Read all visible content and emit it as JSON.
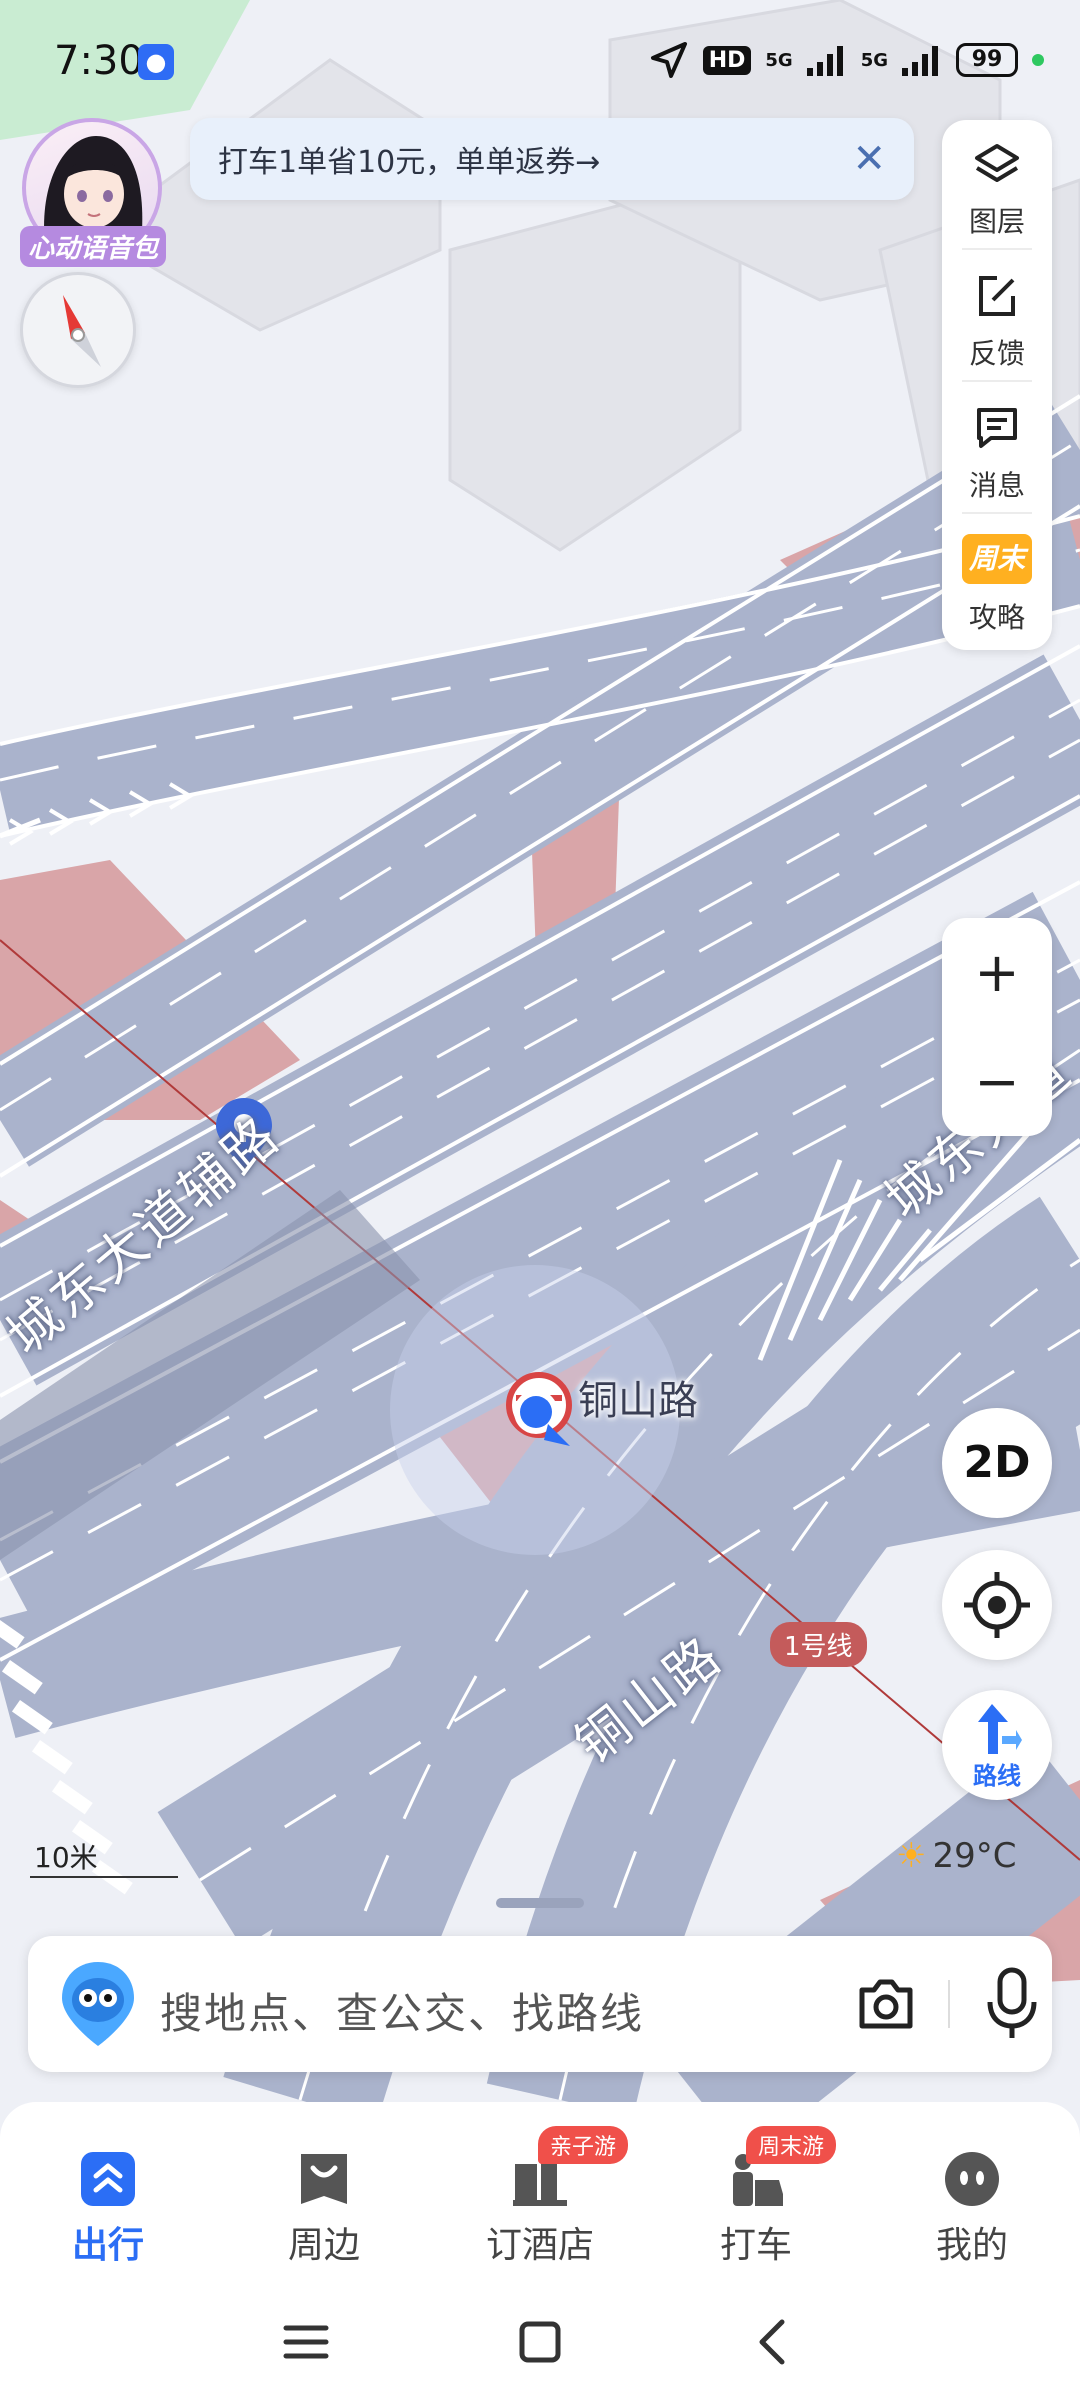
{
  "status_bar": {
    "time": "7:30",
    "app_icon": "paw-icon",
    "hd": "HD",
    "network_1": "5G",
    "network_2": "5G",
    "battery": "99"
  },
  "promo": {
    "text": "打车1单省10元，单单返券→",
    "close": "✕"
  },
  "avatar": {
    "label": "心动语音包"
  },
  "tools": {
    "layers": "图层",
    "feedback": "反馈",
    "messages": "消息",
    "weekend_badge": "周末",
    "guide": "攻略"
  },
  "zoom": {
    "in": "+",
    "out": "−"
  },
  "map": {
    "road_1": "城东大道辅路",
    "road_2": "城东大道",
    "road_3": "铜山路",
    "poi_name": "铜山路",
    "metro_line": "1号线",
    "scale": "10米",
    "weather": "29°C"
  },
  "map_buttons": {
    "view_mode": "2D",
    "route": "路线"
  },
  "search": {
    "placeholder": "搜地点、查公交、找路线"
  },
  "nav": {
    "items": [
      {
        "label": "出行",
        "badge": ""
      },
      {
        "label": "周边",
        "badge": ""
      },
      {
        "label": "订酒店",
        "badge": "亲子游"
      },
      {
        "label": "打车",
        "badge": "周末游"
      },
      {
        "label": "我的",
        "badge": ""
      }
    ]
  },
  "colors": {
    "accent": "#2b6ef5",
    "road": "#aab3cc",
    "metro_block": "#d9a5a8",
    "badge_red": "#f0504a"
  }
}
